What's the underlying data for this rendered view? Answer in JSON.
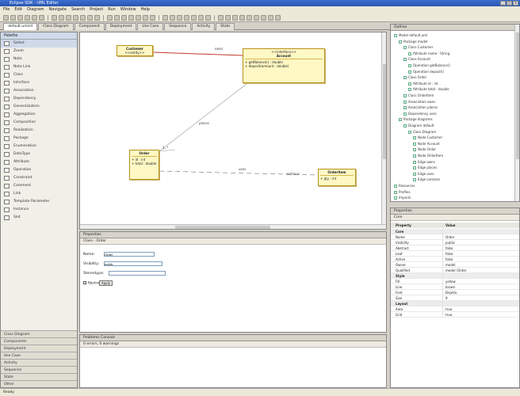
{
  "window": {
    "title": "Eclipse SDK - UML Editor"
  },
  "menu": [
    "File",
    "Edit",
    "Diagram",
    "Navigate",
    "Search",
    "Project",
    "Run",
    "Window",
    "Help"
  ],
  "editor_tabs": [
    {
      "label": "default.umlcd",
      "active": true
    },
    {
      "label": "Class Diagram",
      "active": false
    },
    {
      "label": "Component",
      "active": false
    },
    {
      "label": "Deployment",
      "active": false
    },
    {
      "label": "Use Case",
      "active": false
    },
    {
      "label": "Sequence",
      "active": false
    },
    {
      "label": "Activity",
      "active": false
    },
    {
      "label": "State",
      "active": false
    }
  ],
  "palette": {
    "header": "Palette",
    "items": [
      {
        "label": "Select",
        "sel": true
      },
      {
        "label": "Zoom",
        "sel": false
      },
      {
        "label": "Note",
        "sel": false
      },
      {
        "label": "Note Link",
        "sel": false
      },
      {
        "label": "Class",
        "sel": false
      },
      {
        "label": "Interface",
        "sel": false
      },
      {
        "label": "Association",
        "sel": false
      },
      {
        "label": "Dependency",
        "sel": false
      },
      {
        "label": "Generalization",
        "sel": false
      },
      {
        "label": "Aggregation",
        "sel": false
      },
      {
        "label": "Composition",
        "sel": false
      },
      {
        "label": "Realization",
        "sel": false
      },
      {
        "label": "Package",
        "sel": false
      },
      {
        "label": "Enumeration",
        "sel": false
      },
      {
        "label": "DataType",
        "sel": false
      },
      {
        "label": "Attribute",
        "sel": false
      },
      {
        "label": "Operation",
        "sel": false
      },
      {
        "label": "Constraint",
        "sel": false
      },
      {
        "label": "Comment",
        "sel": false
      },
      {
        "label": "Link",
        "sel": false
      },
      {
        "label": "Template Parameter",
        "sel": false
      },
      {
        "label": "Instance",
        "sel": false
      },
      {
        "label": "Slot",
        "sel": false
      }
    ],
    "sections": [
      "Class Diagram",
      "Components",
      "Deployment",
      "Use Case",
      "Activity",
      "Sequence",
      "State",
      "Other"
    ]
  },
  "diagram": {
    "nodes": [
      {
        "id": "n1",
        "title": "Customer",
        "rows": [
          "<<entity>>"
        ]
      },
      {
        "id": "n2",
        "title": "Account",
        "rows": [
          "<<interface>>",
          "+ getBalance() : double",
          "+ deposit(amount : double)"
        ]
      },
      {
        "id": "n3",
        "title": "Order",
        "rows": [
          "+ id : int",
          "+ total : double"
        ]
      },
      {
        "id": "n4",
        "title": "OrderItem",
        "rows": [
          "+ qty : int"
        ]
      }
    ],
    "edge_labels": [
      "owns",
      "places",
      "uses",
      "1..*",
      "contains"
    ]
  },
  "properties_panel": {
    "title": "Properties",
    "subtitle": "Class - Order",
    "fields": [
      {
        "label": "Name:",
        "value": "Order"
      },
      {
        "label": "Visibility:",
        "value": "public"
      },
      {
        "label": "Stereotype:",
        "value": ""
      }
    ],
    "checkbox_label": "Abstract",
    "button_label": "Apply"
  },
  "problems_panel": {
    "title": "Problems  Console",
    "subtitle": "0 errors, 0 warnings"
  },
  "outline": {
    "title": "Outline",
    "items": [
      "Model default.uml",
      "Package model",
      "Class Customer",
      "Attribute name : String",
      "Class Account",
      "Operation getBalance()",
      "Operation deposit()",
      "Class Order",
      "Attribute id : int",
      "Attribute total : double",
      "Class OrderItem",
      "Association owns",
      "Association places",
      "Dependency uses",
      "Package diagrams",
      "Diagram default",
      "Class Diagram",
      "Node Customer",
      "Node Account",
      "Node Order",
      "Node OrderItem",
      "Edge owns",
      "Edge places",
      "Edge uses",
      "Edge contains",
      "Resources",
      "Profiles",
      "Imports"
    ]
  },
  "property_sheet": {
    "title": "Properties",
    "tab": "Core",
    "header": [
      "Property",
      "Value"
    ],
    "rows": [
      {
        "k": "Core",
        "v": "",
        "cat": true
      },
      {
        "k": "Name",
        "v": "Order",
        "cat": false
      },
      {
        "k": "Visibility",
        "v": "public",
        "cat": false
      },
      {
        "k": "Abstract",
        "v": "false",
        "cat": false
      },
      {
        "k": "Leaf",
        "v": "false",
        "cat": false
      },
      {
        "k": "Active",
        "v": "false",
        "cat": false
      },
      {
        "k": "Owner",
        "v": "model",
        "cat": false
      },
      {
        "k": "Qualified",
        "v": "model::Order",
        "cat": false
      },
      {
        "k": "Style",
        "v": "",
        "cat": true
      },
      {
        "k": "Fill",
        "v": "yellow",
        "cat": false
      },
      {
        "k": "Line",
        "v": "brown",
        "cat": false
      },
      {
        "k": "Font",
        "v": "DejaVu",
        "cat": false
      },
      {
        "k": "Size",
        "v": "9",
        "cat": false
      },
      {
        "k": "Layout",
        "v": "",
        "cat": true
      },
      {
        "k": "Auto",
        "v": "true",
        "cat": false
      },
      {
        "k": "Grid",
        "v": "true",
        "cat": false
      }
    ]
  },
  "status": {
    "text": "Ready"
  }
}
